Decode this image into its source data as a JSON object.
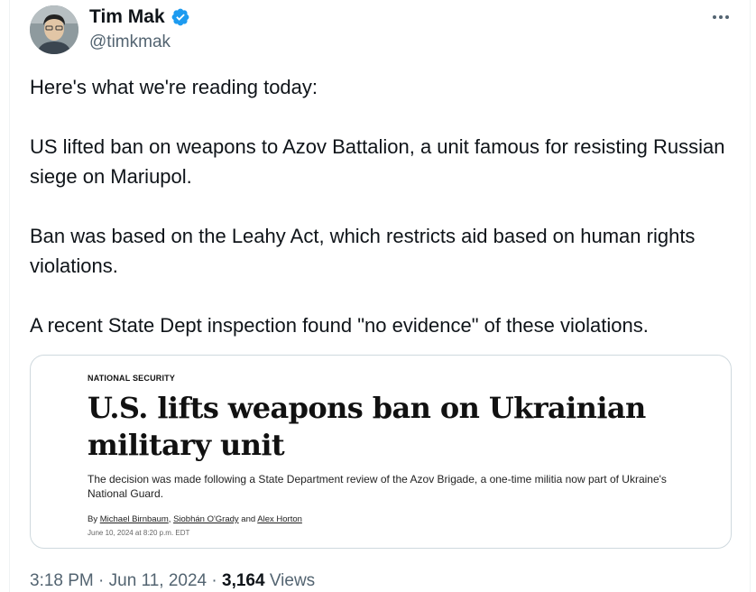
{
  "author": {
    "name": "Tim Mak",
    "handle": "@timkmak",
    "verified_icon": "verified-badge-icon",
    "badge_color": "#1d9bf0"
  },
  "tweet": {
    "paragraphs": [
      "Here's what we're reading today:",
      "US lifted ban on weapons to Azov Battalion, a unit famous for resisting Russian siege on Mariupol.",
      "Ban was based on the Leahy Act, which restricts aid based on human rights violations.",
      "A recent State Dept inspection found \"no evidence\" of these violations."
    ]
  },
  "card": {
    "section": "NATIONAL SECURITY",
    "headline": "U.S. lifts weapons ban on Ukrainian military unit",
    "subhead": "The decision was made following a State Department review of the Azov Brigade, a one-time militia now part of Ukraine's National Guard.",
    "byline_prefix": "By",
    "authors": [
      "Michael Birnbaum",
      "Siobhán O'Grady",
      "Alex Horton"
    ],
    "separator": ",",
    "and": "and",
    "date": "June 10, 2024 at 8:20 p.m. EDT"
  },
  "meta": {
    "time": "3:18 PM",
    "dot1": "·",
    "date": "Jun 11, 2024",
    "dot2": "·",
    "views_count": "3,164",
    "views_label": "Views"
  },
  "colors": {
    "text": "#0f1419",
    "secondary": "#536471",
    "border": "#cfd9de",
    "accent": "#1d9bf0"
  }
}
